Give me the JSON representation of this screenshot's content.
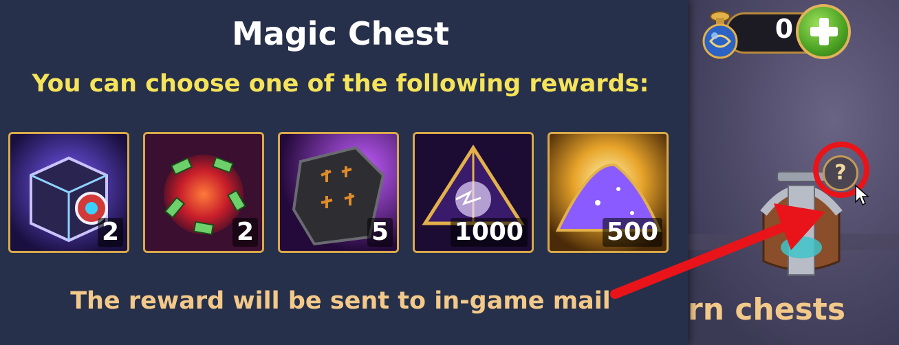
{
  "panel": {
    "title": "Magic Chest",
    "subtitle": "You can choose one of the following rewards:",
    "footer": "The reward will be sent to in-game mail"
  },
  "rewards": [
    {
      "name": "mystery-box",
      "quantity": "2"
    },
    {
      "name": "red-orb",
      "quantity": "2"
    },
    {
      "name": "rune-stone",
      "quantity": "5"
    },
    {
      "name": "crystal-pyramid",
      "quantity": "1000"
    },
    {
      "name": "purple-dust",
      "quantity": "500"
    }
  ],
  "currency": {
    "value": "0"
  },
  "help": {
    "label": "?"
  },
  "background": {
    "line1": "rn chests",
    "line2": ""
  },
  "colors": {
    "title": "#ffffff",
    "subtitle": "#f5e35a",
    "footer": "#f3c98a",
    "frame": "#d9a94a",
    "highlight": "#e8141a"
  }
}
